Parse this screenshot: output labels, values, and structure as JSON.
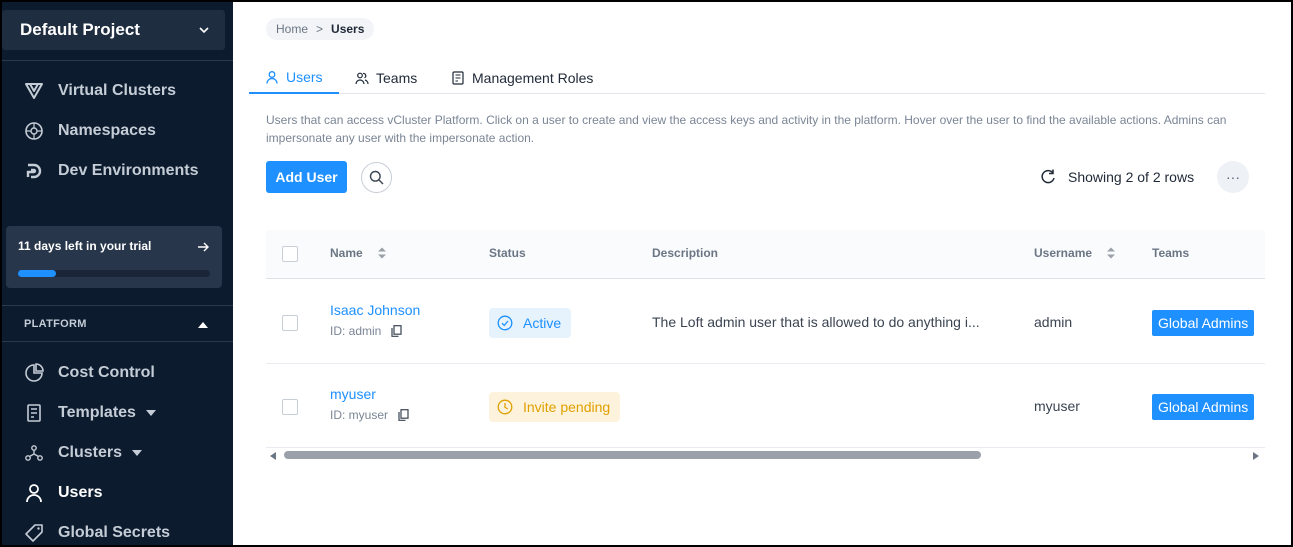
{
  "sidebar": {
    "project": "Default Project",
    "top_items": [
      {
        "label": "Virtual Clusters",
        "icon": "vcluster-icon"
      },
      {
        "label": "Namespaces",
        "icon": "namespace-icon"
      },
      {
        "label": "Dev Environments",
        "icon": "devenv-icon"
      }
    ],
    "trial": {
      "text": "11 days left in your trial",
      "progress": 0.2
    },
    "section": "PLATFORM",
    "platform_items": [
      {
        "label": "Cost Control",
        "icon": "pie-chart-icon"
      },
      {
        "label": "Templates",
        "icon": "template-icon",
        "has_caret": true
      },
      {
        "label": "Clusters",
        "icon": "cluster-icon",
        "has_caret": true
      },
      {
        "label": "Users",
        "icon": "user-icon",
        "active": true
      },
      {
        "label": "Global Secrets",
        "icon": "tag-icon"
      }
    ]
  },
  "breadcrumb": {
    "home": "Home",
    "separator": ">",
    "current": "Users"
  },
  "tabs": [
    {
      "label": "Users",
      "icon": "user-icon",
      "active": true
    },
    {
      "label": "Teams",
      "icon": "team-icon"
    },
    {
      "label": "Management Roles",
      "icon": "roles-icon"
    }
  ],
  "description": "Users that can access vCluster Platform. Click on a user to create and view the access keys and activity in the platform. Hover over the user to find the available actions. Admins can impersonate any user with the impersonate action.",
  "toolbar": {
    "add_user": "Add User",
    "row_count": "Showing 2 of 2 rows",
    "more": "···"
  },
  "table": {
    "columns": [
      "Name",
      "Status",
      "Description",
      "Username",
      "Teams"
    ],
    "rows": [
      {
        "name": "Isaac Johnson",
        "id": "ID: admin",
        "status": "Active",
        "status_type": "active",
        "description": "The Loft admin user that is allowed to do anything i...",
        "username": "admin",
        "team": "Global Admins"
      },
      {
        "name": "myuser",
        "id": "ID: myuser",
        "status": "Invite pending",
        "status_type": "pending",
        "description": "",
        "username": "myuser",
        "team": "Global Admins"
      }
    ]
  },
  "colors": {
    "accent": "#1e90ff",
    "sidebar_bg": "#0d1b2e",
    "pending": "#e0a000"
  }
}
